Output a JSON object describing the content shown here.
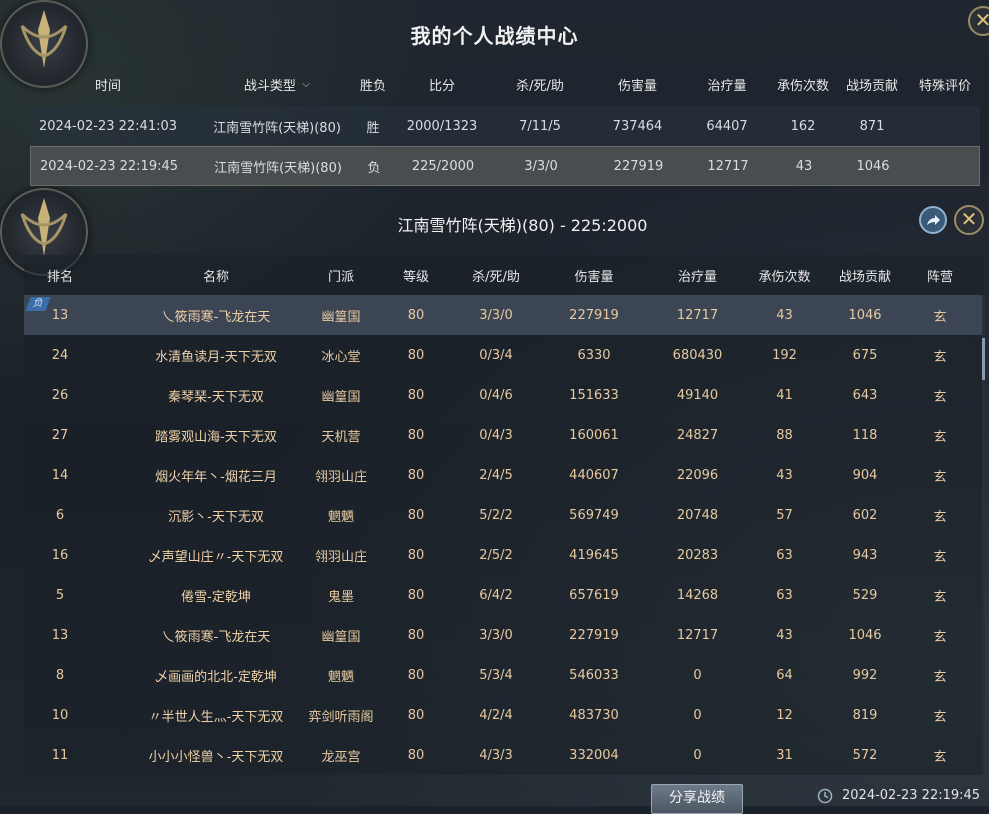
{
  "title": "我的个人战绩中心",
  "history": {
    "headers": {
      "time": "时间",
      "type": "战斗类型",
      "result": "胜负",
      "score": "比分",
      "kda": "杀/死/助",
      "damage": "伤害量",
      "heal": "治疗量",
      "taken": "承伤次数",
      "contrib": "战场贡献",
      "eval": "特殊评价"
    },
    "rows": [
      {
        "time": "2024-02-23 22:41:03",
        "type": "江南雪竹阵(天梯)(80)",
        "result": "胜",
        "score": "2000/1323",
        "kda": "7/11/5",
        "damage": "737464",
        "heal": "64407",
        "taken": "162",
        "contrib": "871",
        "eval": ""
      },
      {
        "time": "2024-02-23 22:19:45",
        "type": "江南雪竹阵(天梯)(80)",
        "result": "负",
        "score": "225/2000",
        "kda": "3/3/0",
        "damage": "227919",
        "heal": "12717",
        "taken": "43",
        "contrib": "1046",
        "eval": ""
      }
    ]
  },
  "detail": {
    "title": "江南雪竹阵(天梯)(80) - 225:2000",
    "self_badge": "负",
    "headers": {
      "rank": "排名",
      "name": "名称",
      "sect": "门派",
      "level": "等级",
      "kda": "杀/死/助",
      "damage": "伤害量",
      "heal": "治疗量",
      "taken": "承伤次数",
      "contrib": "战场贡献",
      "camp": "阵营"
    },
    "rows": [
      {
        "rank": "13",
        "name": "乀筱雨寒-飞龙在天",
        "sect": "幽篁国",
        "level": "80",
        "kda": "3/3/0",
        "damage": "227919",
        "heal": "12717",
        "taken": "43",
        "contrib": "1046",
        "camp": "玄"
      },
      {
        "rank": "24",
        "name": "水清鱼读月-天下无双",
        "sect": "冰心堂",
        "level": "80",
        "kda": "0/3/4",
        "damage": "6330",
        "heal": "680430",
        "taken": "192",
        "contrib": "675",
        "camp": "玄"
      },
      {
        "rank": "26",
        "name": "秦琴琹-天下无双",
        "sect": "幽篁国",
        "level": "80",
        "kda": "0/4/6",
        "damage": "151633",
        "heal": "49140",
        "taken": "41",
        "contrib": "643",
        "camp": "玄"
      },
      {
        "rank": "27",
        "name": "踏雾观山海-天下无双",
        "sect": "天机营",
        "level": "80",
        "kda": "0/4/3",
        "damage": "160061",
        "heal": "24827",
        "taken": "88",
        "contrib": "118",
        "camp": "玄"
      },
      {
        "rank": "14",
        "name": "烟火年年丶-烟花三月",
        "sect": "翎羽山庄",
        "level": "80",
        "kda": "2/4/5",
        "damage": "440607",
        "heal": "22096",
        "taken": "43",
        "contrib": "904",
        "camp": "玄"
      },
      {
        "rank": "6",
        "name": "沉影丶-天下无双",
        "sect": "魍魉",
        "level": "80",
        "kda": "5/2/2",
        "damage": "569749",
        "heal": "20748",
        "taken": "57",
        "contrib": "602",
        "camp": "玄"
      },
      {
        "rank": "16",
        "name": "乄声望山庄〃-天下无双",
        "sect": "翎羽山庄",
        "level": "80",
        "kda": "2/5/2",
        "damage": "419645",
        "heal": "20283",
        "taken": "63",
        "contrib": "943",
        "camp": "玄"
      },
      {
        "rank": "5",
        "name": "倦雪-定乾坤",
        "sect": "鬼墨",
        "level": "80",
        "kda": "6/4/2",
        "damage": "657619",
        "heal": "14268",
        "taken": "63",
        "contrib": "529",
        "camp": "玄"
      },
      {
        "rank": "13",
        "name": "乀筱雨寒-飞龙在天",
        "sect": "幽篁国",
        "level": "80",
        "kda": "3/3/0",
        "damage": "227919",
        "heal": "12717",
        "taken": "43",
        "contrib": "1046",
        "camp": "玄"
      },
      {
        "rank": "8",
        "name": "乄画画的北北-定乾坤",
        "sect": "魍魉",
        "level": "80",
        "kda": "5/3/4",
        "damage": "546033",
        "heal": "0",
        "taken": "64",
        "contrib": "992",
        "camp": "玄"
      },
      {
        "rank": "10",
        "name": "〃半世人生灬-天下无双",
        "sect": "弈剑听雨阁",
        "level": "80",
        "kda": "4/2/4",
        "damage": "483730",
        "heal": "0",
        "taken": "12",
        "contrib": "819",
        "camp": "玄"
      },
      {
        "rank": "11",
        "name": "小小小怪兽丶-天下无双",
        "sect": "龙巫宫",
        "level": "80",
        "kda": "4/3/3",
        "damage": "332004",
        "heal": "0",
        "taken": "31",
        "contrib": "572",
        "camp": "玄"
      }
    ]
  },
  "footer": {
    "share_label": "分享战绩",
    "timestamp": "2024-02-23 22:19:45"
  }
}
